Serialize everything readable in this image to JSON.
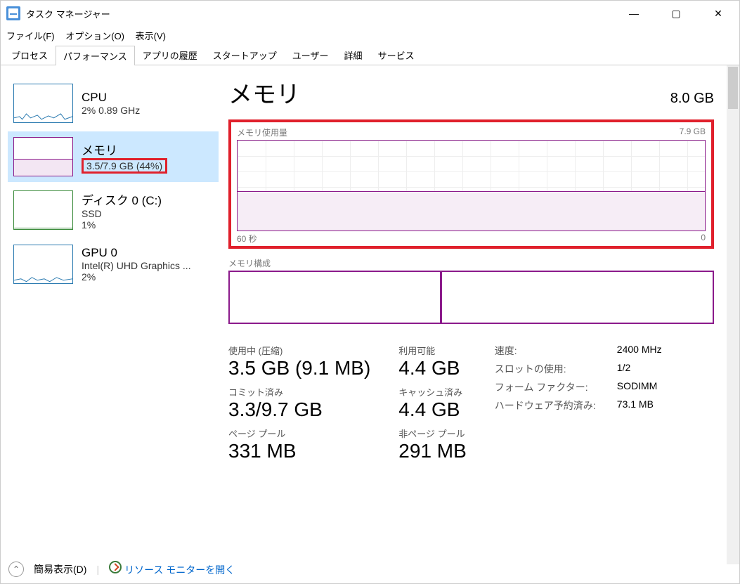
{
  "window": {
    "title": "タスク マネージャー",
    "minimize": "—",
    "maximize": "▢",
    "close": "✕"
  },
  "menu": {
    "file": "ファイル(F)",
    "options": "オプション(O)",
    "view": "表示(V)"
  },
  "tabs": {
    "processes": "プロセス",
    "performance": "パフォーマンス",
    "app_history": "アプリの履歴",
    "startup": "スタートアップ",
    "users": "ユーザー",
    "details": "詳細",
    "services": "サービス"
  },
  "sidebar": {
    "cpu": {
      "title": "CPU",
      "sub": "2%  0.89 GHz"
    },
    "memory": {
      "title": "メモリ",
      "sub": "3.5/7.9 GB (44%)"
    },
    "disk": {
      "title": "ディスク 0 (C:)",
      "sub1": "SSD",
      "sub2": "1%"
    },
    "gpu": {
      "title": "GPU 0",
      "sub1": "Intel(R) UHD Graphics ...",
      "sub2": "2%"
    }
  },
  "main": {
    "title": "メモリ",
    "total": "8.0 GB",
    "usage_label": "メモリ使用量",
    "usage_max": "7.9 GB",
    "xaxis_left": "60 秒",
    "xaxis_right": "0",
    "composition_label": "メモリ構成",
    "stats": {
      "in_use_label": "使用中 (圧縮)",
      "in_use_value": "3.5 GB (9.1 MB)",
      "available_label": "利用可能",
      "available_value": "4.4 GB",
      "committed_label": "コミット済み",
      "committed_value": "3.3/9.7 GB",
      "cached_label": "キャッシュ済み",
      "cached_value": "4.4 GB",
      "paged_label": "ページ プール",
      "paged_value": "331 MB",
      "nonpaged_label": "非ページ プール",
      "nonpaged_value": "291 MB",
      "speed_label": "速度:",
      "speed_value": "2400 MHz",
      "slots_label": "スロットの使用:",
      "slots_value": "1/2",
      "form_label": "フォーム ファクター:",
      "form_value": "SODIMM",
      "reserved_label": "ハードウェア予約済み:",
      "reserved_value": "73.1 MB"
    }
  },
  "footer": {
    "fewer": "簡易表示(D)",
    "resource_monitor": "リソース モニターを開く"
  },
  "chart_data": {
    "type": "area",
    "title": "メモリ使用量",
    "x": [
      60,
      50,
      40,
      30,
      20,
      10,
      0
    ],
    "values": [
      3.5,
      3.5,
      3.5,
      3.5,
      3.5,
      3.5,
      3.5
    ],
    "xlabel": "秒",
    "ylabel": "GB",
    "ylim": [
      0,
      7.9
    ]
  }
}
